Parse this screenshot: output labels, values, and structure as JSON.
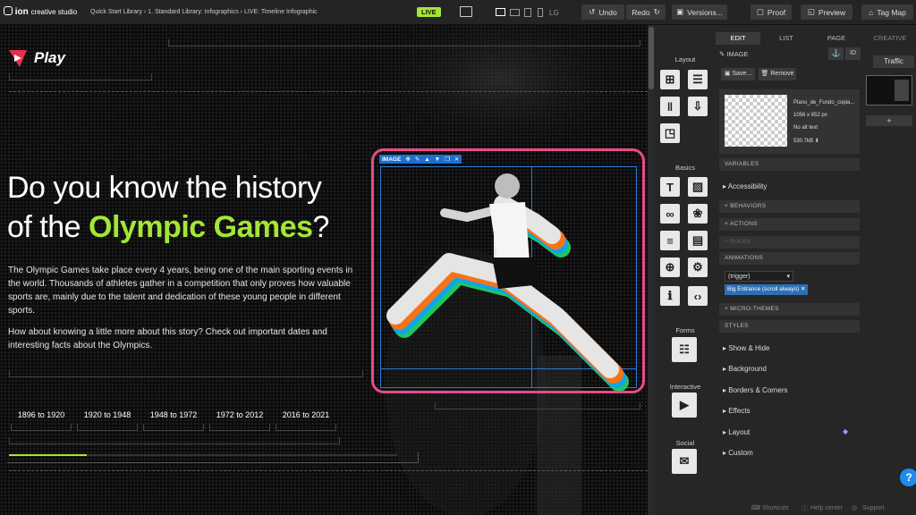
{
  "topbar": {
    "brand": "ion",
    "brand_sub": "creative studio",
    "breadcrumb": "Quick Start Library  ›  1. Standard Library: Infographics  ›  LIVE: Timeline Infographic",
    "live_badge": "LIVE",
    "device_label": "LG",
    "undo_label": "Undo",
    "redo_label": "Redo",
    "versions_label": "Versions...",
    "proof_label": "Proof",
    "preview_label": "Preview",
    "tagmap_label": "Tag Map"
  },
  "page": {
    "logo_text": "Play",
    "headline_1": "Do you know the history",
    "headline_2a": "of the ",
    "headline_2b": "Olympic Games",
    "headline_2c": "?",
    "paragraph_1": "The Olympic Games take place every 4 years, being one of the main sporting events in the world. Thousands of athletes gather in a competition that only proves how valuable sports are, mainly due to the talent and dedication of these young people in different sports.",
    "paragraph_2": "How about knowing a little more about this story? Check out important dates and interesting facts about the Olympics.",
    "timeline": [
      "1896 to 1920",
      "1920 to 1948",
      "1948 to 1972",
      "1972 to 2012",
      "2016 to 2021"
    ],
    "image_toolbar_label": "IMAGE",
    "timeline_progress": 0.2
  },
  "panel": {
    "tabs": [
      "EDIT",
      "LIST",
      "PAGE"
    ],
    "creative_tab": "CREATIVE",
    "traffic_label": "Traffic",
    "add_label": "+",
    "element_type": "IMAGE",
    "id_label": "ID",
    "save_label": "Save...",
    "remove_label": "Remove",
    "file_name": "Plano_de_Fundo_copia...",
    "file_dims": "1056 x 852 px",
    "alt_text": "No alt text",
    "file_size": "530.7kB",
    "sections": {
      "variables": "VARIABLES",
      "accessibility": "Accessibility",
      "behaviors": "+ BEHAVIORS",
      "actions": "+ ACTIONS",
      "rules": "+ RULES",
      "animations": "ANIMATIONS",
      "trigger": "(trigger)",
      "animation_tag": "Big Entrance (scroll always)",
      "micro_themes": "+ MICRO-THEMES",
      "styles": "STYLES"
    },
    "styles": [
      "Show & Hide",
      "Background",
      "Borders & Corners",
      "Effects",
      "Layout",
      "Custom"
    ],
    "tools": {
      "layout": "Layout",
      "basics": "Basics",
      "forms": "Forms",
      "interactive": "Interactive",
      "social": "Social"
    },
    "footer": {
      "shortcuts": "Shortcuts",
      "help": "Help center",
      "support": "Support"
    },
    "help_badge": "?"
  },
  "colors": {
    "accent_green": "#a3e635",
    "selection_pink": "#e84a8a",
    "selection_blue": "#1d6fd1"
  }
}
